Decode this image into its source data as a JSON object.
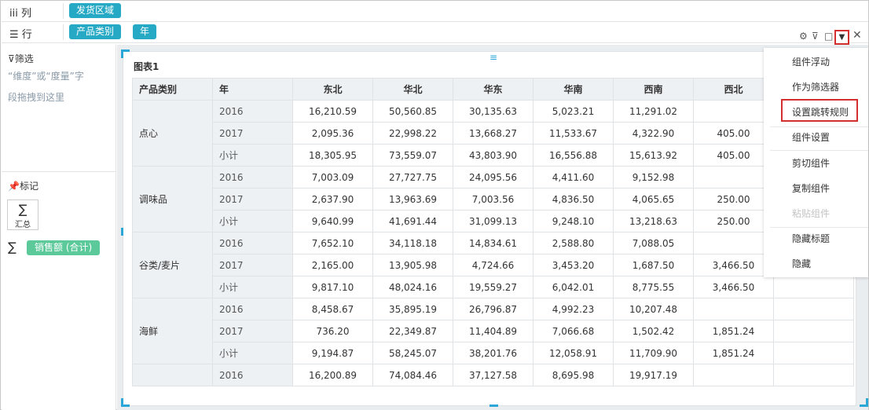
{
  "shelves": {
    "columns": {
      "icon": "column-icon",
      "label": "iii 列",
      "pills": [
        "发货区域"
      ]
    },
    "rows": {
      "icon": "row-list-icon",
      "label": "☰ 行",
      "pills": [
        "产品类别",
        "年"
      ]
    }
  },
  "filter": {
    "title": "筛选",
    "hint_line1": "“维度”或“度量”字",
    "hint_line2": "段拖拽到这里"
  },
  "marks": {
    "title": "标记",
    "sum_label": "汇总",
    "measure": "销售额 (合计)"
  },
  "widget": {
    "title": "图表1"
  },
  "table": {
    "headers": [
      "产品类别",
      "年",
      "东北",
      "华北",
      "华东",
      "华南",
      "西南",
      "西北",
      ""
    ],
    "groups": [
      {
        "category": "点心",
        "rows": [
          {
            "year": "2016",
            "values": [
              "16,210.59",
              "50,560.85",
              "30,135.63",
              "5,023.21",
              "11,291.02",
              "",
              ""
            ]
          },
          {
            "year": "2017",
            "values": [
              "2,095.36",
              "22,998.22",
              "13,668.27",
              "11,533.67",
              "4,322.90",
              "405.00",
              ""
            ]
          },
          {
            "year": "小计",
            "values": [
              "18,305.95",
              "73,559.07",
              "43,803.90",
              "16,556.88",
              "15,613.92",
              "405.00",
              ""
            ]
          }
        ]
      },
      {
        "category": "调味品",
        "rows": [
          {
            "year": "2016",
            "values": [
              "7,003.09",
              "27,727.75",
              "24,095.56",
              "4,411.60",
              "9,152.98",
              "",
              ""
            ]
          },
          {
            "year": "2017",
            "values": [
              "2,637.90",
              "13,963.69",
              "7,003.56",
              "4,836.50",
              "4,065.65",
              "250.00",
              ""
            ]
          },
          {
            "year": "小计",
            "values": [
              "9,640.99",
              "41,691.44",
              "31,099.13",
              "9,248.10",
              "13,218.63",
              "250.00",
              ""
            ]
          }
        ]
      },
      {
        "category": "谷类/麦片",
        "rows": [
          {
            "year": "2016",
            "values": [
              "7,652.10",
              "34,118.18",
              "14,834.61",
              "2,588.80",
              "7,088.05",
              "",
              ""
            ]
          },
          {
            "year": "2017",
            "values": [
              "2,165.00",
              "13,905.98",
              "4,724.66",
              "3,453.20",
              "1,687.50",
              "3,466.50",
              ""
            ]
          },
          {
            "year": "小计",
            "values": [
              "9,817.10",
              "48,024.16",
              "19,559.27",
              "6,042.01",
              "8,775.55",
              "3,466.50",
              ""
            ]
          }
        ]
      },
      {
        "category": "海鲜",
        "rows": [
          {
            "year": "2016",
            "values": [
              "8,458.67",
              "35,895.19",
              "26,796.87",
              "4,992.23",
              "10,207.48",
              "",
              ""
            ]
          },
          {
            "year": "2017",
            "values": [
              "736.20",
              "22,349.87",
              "11,404.89",
              "7,066.68",
              "1,502.42",
              "1,851.24",
              ""
            ]
          },
          {
            "year": "小计",
            "values": [
              "9,194.87",
              "58,245.07",
              "38,201.76",
              "12,058.91",
              "11,709.90",
              "1,851.24",
              ""
            ]
          }
        ]
      },
      {
        "category": "",
        "rows": [
          {
            "year": "2016",
            "values": [
              "16,200.89",
              "74,084.46",
              "37,127.58",
              "8,695.98",
              "19,917.19",
              "",
              ""
            ]
          }
        ]
      }
    ]
  },
  "toolbar": {
    "icons": [
      "gear-icon",
      "filter-icon",
      "maximize-icon",
      "dropdown-icon",
      "close-icon"
    ]
  },
  "menu": {
    "items": [
      {
        "label": "组件浮动",
        "disabled": false
      },
      {
        "label": "作为筛选器",
        "disabled": false
      },
      {
        "label": "设置跳转规则",
        "disabled": false,
        "highlighted": true
      },
      {
        "label": "组件设置",
        "disabled": false
      },
      {
        "label": "剪切组件",
        "disabled": false
      },
      {
        "label": "复制组件",
        "disabled": false
      },
      {
        "label": "粘贴组件",
        "disabled": true
      },
      {
        "label": "隐藏标题",
        "disabled": false
      },
      {
        "label": "隐藏",
        "disabled": false
      }
    ]
  },
  "colors": {
    "accent": "#26a9c4",
    "measure": "#5cc99a",
    "highlight": "#d32f2f"
  }
}
